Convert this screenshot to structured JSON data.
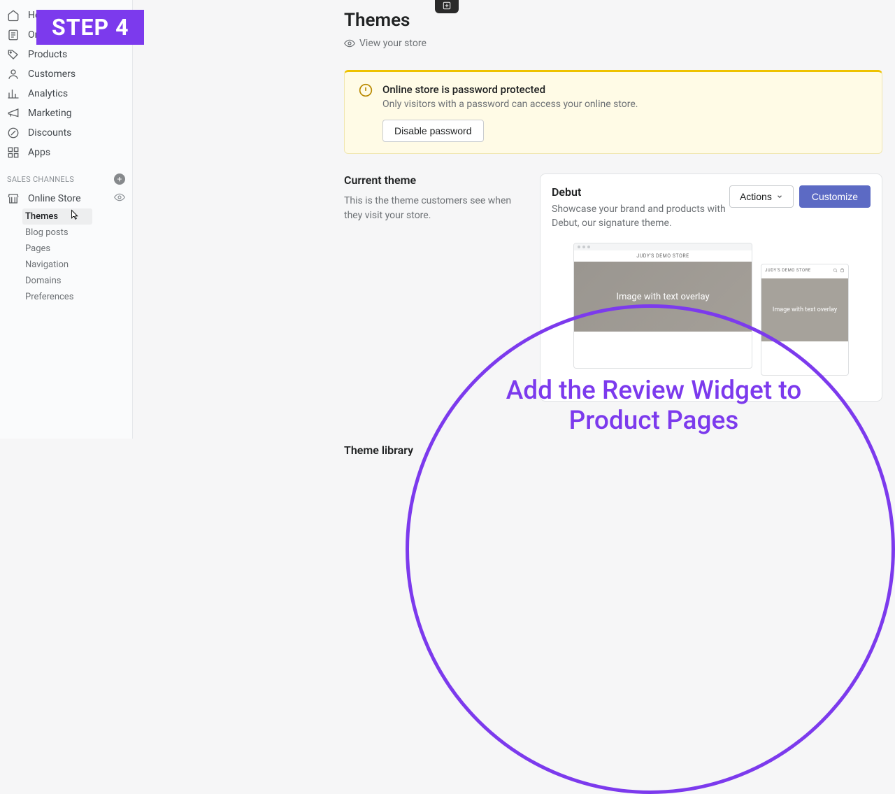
{
  "step_badge": "STEP 4",
  "sidebar": {
    "main_items": [
      {
        "label": "Home",
        "icon": "home"
      },
      {
        "label": "Orders",
        "icon": "orders"
      },
      {
        "label": "Products",
        "icon": "products"
      },
      {
        "label": "Customers",
        "icon": "customers"
      },
      {
        "label": "Analytics",
        "icon": "analytics"
      },
      {
        "label": "Marketing",
        "icon": "marketing"
      },
      {
        "label": "Discounts",
        "icon": "discounts"
      },
      {
        "label": "Apps",
        "icon": "apps"
      }
    ],
    "channels_header": "SALES CHANNELS",
    "online_store_label": "Online Store",
    "sub_items": [
      {
        "label": "Themes",
        "active": true
      },
      {
        "label": "Blog posts",
        "active": false
      },
      {
        "label": "Pages",
        "active": false
      },
      {
        "label": "Navigation",
        "active": false
      },
      {
        "label": "Domains",
        "active": false
      },
      {
        "label": "Preferences",
        "active": false
      }
    ]
  },
  "page": {
    "title": "Themes",
    "view_store": "View your store"
  },
  "alert": {
    "title": "Online store is password protected",
    "desc": "Only visitors with a password can access your online store.",
    "button": "Disable password"
  },
  "current_theme": {
    "heading": "Current theme",
    "desc": "This is the theme customers see when they visit your store."
  },
  "theme_card": {
    "name": "Debut",
    "desc": "Showcase your brand and products with Debut, our signature theme.",
    "actions_btn": "Actions",
    "customize_btn": "Customize",
    "preview_store_name": "JUDY'S DEMO STORE",
    "preview_hero_text": "Image with text overlay",
    "preview_mobile_store_name": "JUDY'S DEMO STORE",
    "preview_mobile_hero_text": "Image with text overlay"
  },
  "library": {
    "heading": "Theme library"
  },
  "overlay_text": "Add the Review Widget to Product Pages"
}
